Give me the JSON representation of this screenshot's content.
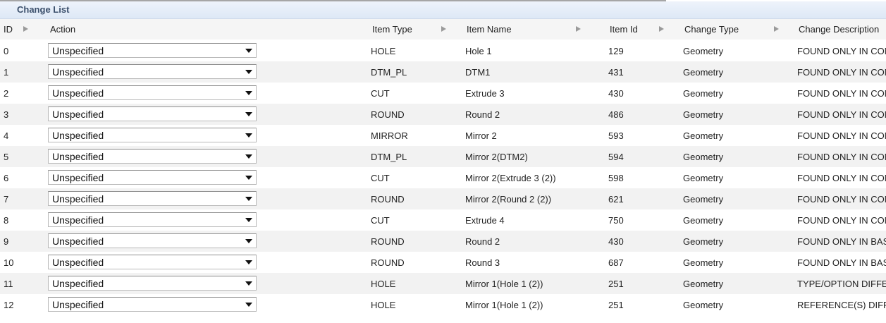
{
  "panel": {
    "title": "Change List"
  },
  "columns": {
    "id": "ID",
    "action": "Action",
    "item_type": "Item Type",
    "item_name": "Item Name",
    "item_id": "Item Id",
    "change_type": "Change Type",
    "change_description": "Change Description"
  },
  "rows": [
    {
      "id": "0",
      "action": "Unspecified",
      "item_type": "HOLE",
      "item_name": "Hole 1",
      "item_id": "129",
      "change_type": "Geometry",
      "change_description": "FOUND ONLY IN COM"
    },
    {
      "id": "1",
      "action": "Unspecified",
      "item_type": "DTM_PL",
      "item_name": "DTM1",
      "item_id": "431",
      "change_type": "Geometry",
      "change_description": "FOUND ONLY IN COM"
    },
    {
      "id": "2",
      "action": "Unspecified",
      "item_type": "CUT",
      "item_name": "Extrude 3",
      "item_id": "430",
      "change_type": "Geometry",
      "change_description": "FOUND ONLY IN COM"
    },
    {
      "id": "3",
      "action": "Unspecified",
      "item_type": "ROUND",
      "item_name": "Round 2",
      "item_id": "486",
      "change_type": "Geometry",
      "change_description": "FOUND ONLY IN COM"
    },
    {
      "id": "4",
      "action": "Unspecified",
      "item_type": "MIRROR",
      "item_name": "Mirror 2",
      "item_id": "593",
      "change_type": "Geometry",
      "change_description": "FOUND ONLY IN COM"
    },
    {
      "id": "5",
      "action": "Unspecified",
      "item_type": "DTM_PL",
      "item_name": "Mirror 2(DTM2)",
      "item_id": "594",
      "change_type": "Geometry",
      "change_description": "FOUND ONLY IN COM"
    },
    {
      "id": "6",
      "action": "Unspecified",
      "item_type": "CUT",
      "item_name": "Mirror 2(Extrude 3 (2))",
      "item_id": "598",
      "change_type": "Geometry",
      "change_description": "FOUND ONLY IN COM"
    },
    {
      "id": "7",
      "action": "Unspecified",
      "item_type": "ROUND",
      "item_name": "Mirror 2(Round 2 (2))",
      "item_id": "621",
      "change_type": "Geometry",
      "change_description": "FOUND ONLY IN COM"
    },
    {
      "id": "8",
      "action": "Unspecified",
      "item_type": "CUT",
      "item_name": "Extrude 4",
      "item_id": "750",
      "change_type": "Geometry",
      "change_description": "FOUND ONLY IN COM"
    },
    {
      "id": "9",
      "action": "Unspecified",
      "item_type": "ROUND",
      "item_name": "Round 2",
      "item_id": "430",
      "change_type": "Geometry",
      "change_description": "FOUND ONLY IN BAS"
    },
    {
      "id": "10",
      "action": "Unspecified",
      "item_type": "ROUND",
      "item_name": "Round 3",
      "item_id": "687",
      "change_type": "Geometry",
      "change_description": "FOUND ONLY IN BAS"
    },
    {
      "id": "11",
      "action": "Unspecified",
      "item_type": "HOLE",
      "item_name": "Mirror 1(Hole 1 (2))",
      "item_id": "251",
      "change_type": "Geometry",
      "change_description": "TYPE/OPTION DIFFE"
    },
    {
      "id": "12",
      "action": "Unspecified",
      "item_type": "HOLE",
      "item_name": "Mirror 1(Hole 1 (2))",
      "item_id": "251",
      "change_type": "Geometry",
      "change_description": "REFERENCE(S) DIFF"
    }
  ]
}
